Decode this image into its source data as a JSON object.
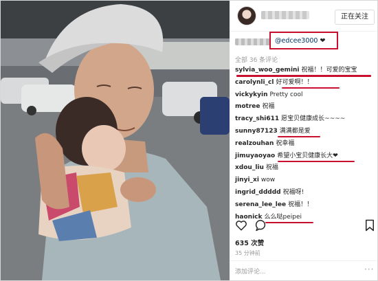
{
  "post": {
    "follow_label": "正在关注",
    "caption_mention": "@edcee3000",
    "caption_heart": "❤",
    "all_comments_label": "全部 36 条评论",
    "likes_label": "635 次赞",
    "time_label": "35 分钟前",
    "add_comment_placeholder": "添加评论...",
    "more_label": "···"
  },
  "comments": [
    {
      "user": "sylvia_woo_gemini",
      "text": "祝福！！可爱的宝宝"
    },
    {
      "user": "carolynli_cl",
      "text": "好可爱啊！！"
    },
    {
      "user": "vickykyin",
      "text": "Pretty cool"
    },
    {
      "user": "motree",
      "text": "祝福"
    },
    {
      "user": "tracy_shi611",
      "text": "愿宝贝健康成长~~~~"
    },
    {
      "user": "sunny87123",
      "text": "满满都是爱"
    },
    {
      "user": "realzouhan",
      "text": "祝幸福"
    },
    {
      "user": "jimuyaoyao",
      "text": "希望小宝贝健康长大❤"
    },
    {
      "user": "xdou_liu",
      "text": "祝福"
    },
    {
      "user": "jinyi_xi",
      "text": "wow"
    },
    {
      "user": "ingrid_ddddd",
      "text": "祝福呀!"
    },
    {
      "user": "serena_lee_lee",
      "text": "祝福！！"
    },
    {
      "user": "haonick",
      "text": "么么哒peipei"
    }
  ],
  "colors": {
    "highlight": "#c8102e",
    "link": "#003569"
  },
  "icons": [
    "heart-icon",
    "comment-icon",
    "bookmark-icon"
  ]
}
